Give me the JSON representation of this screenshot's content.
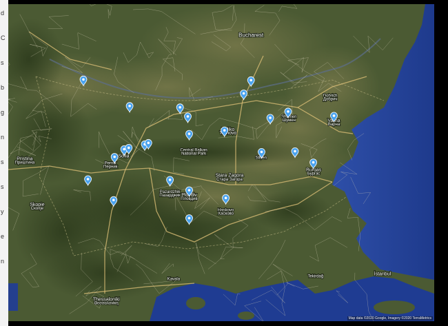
{
  "left_strip": {
    "letters": [
      "d",
      "C",
      "s",
      "b",
      "g",
      "n",
      "s",
      "s",
      "y",
      "e",
      "n"
    ]
  },
  "map": {
    "colors": {
      "land": "#4b5a33",
      "sea": "#2a46a0",
      "road_major": "#e1c37a",
      "road_minor": "#d9d2b8",
      "pin": "#4aa3ef"
    },
    "labels": [
      {
        "text": "Bucharest",
        "x": 26.1,
        "y": 44.43,
        "size": "big",
        "name": "label-bucharest"
      },
      {
        "text": "Veliko",
        "x": 25.6,
        "y": 43.08,
        "size": "med",
        "name": "label-veliko"
      },
      {
        "text": "Tarnovo",
        "x": 25.6,
        "y": 43.03,
        "size": "med",
        "name": "label-tarnovo"
      },
      {
        "text": "Sofia",
        "x": 23.32,
        "y": 42.7,
        "size": "med",
        "name": "label-sofia"
      },
      {
        "text": "Pristina",
        "x": 21.16,
        "y": 42.66,
        "size": "med",
        "name": "label-pristina"
      },
      {
        "text": "Приштина",
        "x": 21.16,
        "y": 42.61,
        "size": "small",
        "name": "label-pristina-cyr"
      },
      {
        "text": "Skopje",
        "x": 21.43,
        "y": 42.0,
        "size": "med",
        "name": "label-skopje"
      },
      {
        "text": "Скопје",
        "x": 21.43,
        "y": 41.95,
        "size": "small",
        "name": "label-skopje-cyr"
      },
      {
        "text": "Pernik",
        "x": 23.03,
        "y": 42.6,
        "size": "small",
        "name": "label-pernik"
      },
      {
        "text": "Перник",
        "x": 23.03,
        "y": 42.55,
        "size": "small",
        "name": "label-pernik-cyr"
      },
      {
        "text": "Pazardzhik",
        "x": 24.33,
        "y": 42.19,
        "size": "small",
        "name": "label-pazardzhik"
      },
      {
        "text": "Пазарджик",
        "x": 24.33,
        "y": 42.14,
        "size": "small",
        "name": "label-pazardzhik-cyr"
      },
      {
        "text": "Plovdiv",
        "x": 24.75,
        "y": 42.14,
        "size": "med",
        "name": "label-plovdiv"
      },
      {
        "text": "Пловдив",
        "x": 24.75,
        "y": 42.09,
        "size": "small",
        "name": "label-plovdiv-cyr"
      },
      {
        "text": "Stara Zagora",
        "x": 25.63,
        "y": 42.42,
        "size": "med",
        "name": "label-stara-zagora"
      },
      {
        "text": "Стара Загора",
        "x": 25.63,
        "y": 42.37,
        "size": "small",
        "name": "label-stara-zagora-cyr"
      },
      {
        "text": "Sliven",
        "x": 26.32,
        "y": 42.68,
        "size": "small",
        "name": "label-sliven"
      },
      {
        "text": "Haskovo",
        "x": 25.55,
        "y": 41.93,
        "size": "small",
        "name": "label-haskovo"
      },
      {
        "text": "Хасково",
        "x": 25.55,
        "y": 41.88,
        "size": "small",
        "name": "label-haskovo-cyr"
      },
      {
        "text": "Varna",
        "x": 27.91,
        "y": 43.21,
        "size": "med",
        "name": "label-varna"
      },
      {
        "text": "Варна",
        "x": 27.91,
        "y": 43.16,
        "size": "small",
        "name": "label-varna-cyr"
      },
      {
        "text": "Burgas",
        "x": 27.47,
        "y": 42.5,
        "size": "med",
        "name": "label-burgas"
      },
      {
        "text": "Бургас",
        "x": 27.47,
        "y": 42.45,
        "size": "small",
        "name": "label-burgas-cyr"
      },
      {
        "text": "Shumen",
        "x": 26.93,
        "y": 43.27,
        "size": "small",
        "name": "label-shumen"
      },
      {
        "text": "Шумен",
        "x": 26.93,
        "y": 43.22,
        "size": "small",
        "name": "label-shumen-cyr"
      },
      {
        "text": "Dobrich",
        "x": 27.83,
        "y": 43.57,
        "size": "small",
        "name": "label-dobrich"
      },
      {
        "text": "Добрич",
        "x": 27.83,
        "y": 43.52,
        "size": "small",
        "name": "label-dobrich-cyr"
      },
      {
        "text": "Thessaloniki",
        "x": 22.94,
        "y": 40.64,
        "size": "med",
        "name": "label-thessaloniki"
      },
      {
        "text": "Θεσσαλονίκη",
        "x": 22.94,
        "y": 40.59,
        "size": "small",
        "name": "label-thessaloniki-cyr"
      },
      {
        "text": "Kavala",
        "x": 24.41,
        "y": 40.94,
        "size": "small",
        "name": "label-kavala"
      },
      {
        "text": "Tekirdağ",
        "x": 27.51,
        "y": 40.98,
        "size": "small",
        "name": "label-tekirdag"
      },
      {
        "text": "İstanbul",
        "x": 28.97,
        "y": 41.01,
        "size": "med",
        "name": "label-istanbul"
      },
      {
        "text": "Central Balkan",
        "x": 24.85,
        "y": 42.79,
        "size": "small",
        "name": "label-central-balkan"
      },
      {
        "text": "National Park",
        "x": 24.85,
        "y": 42.74,
        "size": "small",
        "name": "label-national-park"
      }
    ],
    "pins": [
      {
        "x": 22.44,
        "y": 43.73,
        "name": "pin-1"
      },
      {
        "x": 23.45,
        "y": 43.35,
        "name": "pin-2"
      },
      {
        "x": 24.55,
        "y": 43.33,
        "name": "pin-3"
      },
      {
        "x": 24.72,
        "y": 43.2,
        "name": "pin-4"
      },
      {
        "x": 24.75,
        "y": 42.95,
        "name": "pin-5"
      },
      {
        "x": 25.52,
        "y": 43.0,
        "name": "pin-6"
      },
      {
        "x": 26.1,
        "y": 43.72,
        "name": "pin-7"
      },
      {
        "x": 25.94,
        "y": 43.53,
        "name": "pin-8"
      },
      {
        "x": 26.52,
        "y": 43.18,
        "name": "pin-9"
      },
      {
        "x": 26.91,
        "y": 43.27,
        "name": "pin-10"
      },
      {
        "x": 27.91,
        "y": 43.21,
        "name": "pin-11"
      },
      {
        "x": 23.33,
        "y": 42.73,
        "name": "pin-12"
      },
      {
        "x": 23.43,
        "y": 42.75,
        "name": "pin-13"
      },
      {
        "x": 23.78,
        "y": 42.8,
        "name": "pin-14"
      },
      {
        "x": 23.86,
        "y": 42.82,
        "name": "pin-15"
      },
      {
        "x": 23.12,
        "y": 42.62,
        "name": "pin-16"
      },
      {
        "x": 22.54,
        "y": 42.3,
        "name": "pin-17"
      },
      {
        "x": 23.1,
        "y": 42.0,
        "name": "pin-18"
      },
      {
        "x": 24.33,
        "y": 42.29,
        "name": "pin-19"
      },
      {
        "x": 24.75,
        "y": 42.14,
        "name": "pin-20"
      },
      {
        "x": 25.55,
        "y": 42.03,
        "name": "pin-21"
      },
      {
        "x": 24.75,
        "y": 41.74,
        "name": "pin-22"
      },
      {
        "x": 26.33,
        "y": 42.69,
        "name": "pin-23"
      },
      {
        "x": 27.06,
        "y": 42.7,
        "name": "pin-24"
      },
      {
        "x": 27.46,
        "y": 42.54,
        "name": "pin-25"
      }
    ],
    "sea_labels": [],
    "attribution": "Map data ©2020 Google, Imagery ©2020 TerraMetrics"
  }
}
